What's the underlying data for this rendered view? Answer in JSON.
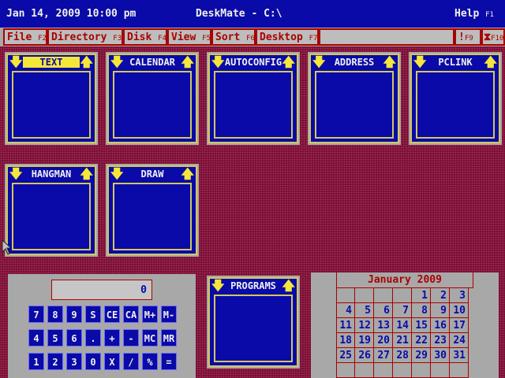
{
  "title_bar": {
    "datetime": "Jan 14, 2009  10:00 pm",
    "app_title": "DeskMate - C:\\",
    "help": "Help",
    "help_key": "F1"
  },
  "menu": {
    "items": [
      {
        "label": "File",
        "key": "F2"
      },
      {
        "label": "Directory",
        "key": "F3"
      },
      {
        "label": "Disk",
        "key": "F4"
      },
      {
        "label": "View",
        "key": "F5"
      },
      {
        "label": "Sort",
        "key": "F6"
      },
      {
        "label": "Desktop",
        "key": "F7"
      }
    ],
    "right_items": [
      {
        "label": "!",
        "key": "F9"
      },
      {
        "label": "⧗",
        "key": "F10"
      }
    ]
  },
  "apps": [
    {
      "label": "TEXT",
      "selected": true
    },
    {
      "label": "CALENDAR",
      "selected": false
    },
    {
      "label": "AUTOCONFIG",
      "selected": false
    },
    {
      "label": "ADDRESS",
      "selected": false
    },
    {
      "label": "PCLINK",
      "selected": false
    },
    {
      "label": "HANGMAN",
      "selected": false
    },
    {
      "label": "DRAW",
      "selected": false
    }
  ],
  "programs": {
    "label": "PROGRAMS"
  },
  "calculator": {
    "display": "0",
    "rows": [
      [
        "7",
        "8",
        "9",
        "S",
        "CE",
        "CA",
        "M+",
        "M-"
      ],
      [
        "4",
        "5",
        "6",
        ".",
        "+",
        "-",
        "MC",
        "MR"
      ],
      [
        "1",
        "2",
        "3",
        "0",
        "X",
        "/",
        "%",
        "="
      ]
    ]
  },
  "calendar": {
    "title": "January 2009",
    "weeks": [
      [
        "",
        "",
        "",
        "",
        "1",
        "2",
        "3"
      ],
      [
        "4",
        "5",
        "6",
        "7",
        "8",
        "9",
        "10"
      ],
      [
        "11",
        "12",
        "13",
        "14",
        "15",
        "16",
        "17"
      ],
      [
        "18",
        "19",
        "20",
        "21",
        "22",
        "23",
        "24"
      ],
      [
        "25",
        "26",
        "27",
        "28",
        "29",
        "30",
        "31"
      ],
      [
        "",
        "",
        "",
        "",
        "",
        "",
        ""
      ]
    ]
  },
  "icons": {
    "down_arrow": "down-arrow-icon",
    "up_arrow": "up-arrow-icon",
    "pointer": "mouse-pointer-icon"
  },
  "colors": {
    "desktop": "#7a0e34",
    "window_blue": "#0a0aa8",
    "accent_yellow": "#f5e63a",
    "menu_red": "#aa0000",
    "panel_gray": "#a8a8a8"
  }
}
